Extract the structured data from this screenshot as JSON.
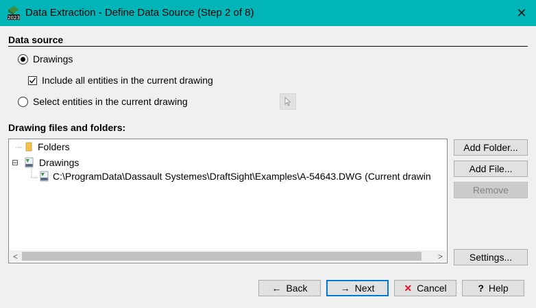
{
  "window": {
    "title": "Data Extraction - Define Data Source (Step 2 of 8)",
    "app_icon": "draftsight-2023-icon",
    "app_icon_label": "2023",
    "close_glyph": "✕"
  },
  "data_source": {
    "heading": "Data source",
    "option_drawings": {
      "label": "Drawings",
      "selected": true
    },
    "include_all": {
      "label": "Include all entities in the current drawing",
      "checked": true
    },
    "option_select": {
      "label": "Select entities in the current drawing",
      "selected": false
    },
    "pick_icon": "cursor-select-icon"
  },
  "files": {
    "heading": "Drawing files and folders:",
    "tree": {
      "folders_label": "Folders",
      "drawings_label": "Drawings",
      "expander": "⊟",
      "file_path": "C:\\ProgramData\\Dassault Systemes\\DraftSight\\Examples\\A-54643.DWG (Current drawin",
      "dwg_icon_label": "DWG"
    }
  },
  "side_buttons": {
    "add_folder": "Add Folder...",
    "add_file": "Add File...",
    "remove": "Remove",
    "settings": "Settings..."
  },
  "footer": {
    "back": "Back",
    "back_glyph": "←",
    "next": "Next",
    "next_glyph": "→",
    "cancel": "Cancel",
    "cancel_glyph": "✕",
    "help": "Help",
    "help_glyph": "?"
  },
  "colors": {
    "titlebar": "#00b5b8",
    "accent_blue": "#0078d7",
    "cancel_red": "#e81123",
    "folder_yellow": "#f2c14e"
  },
  "scroll": {
    "left_arrow": "<",
    "right_arrow": ">"
  }
}
